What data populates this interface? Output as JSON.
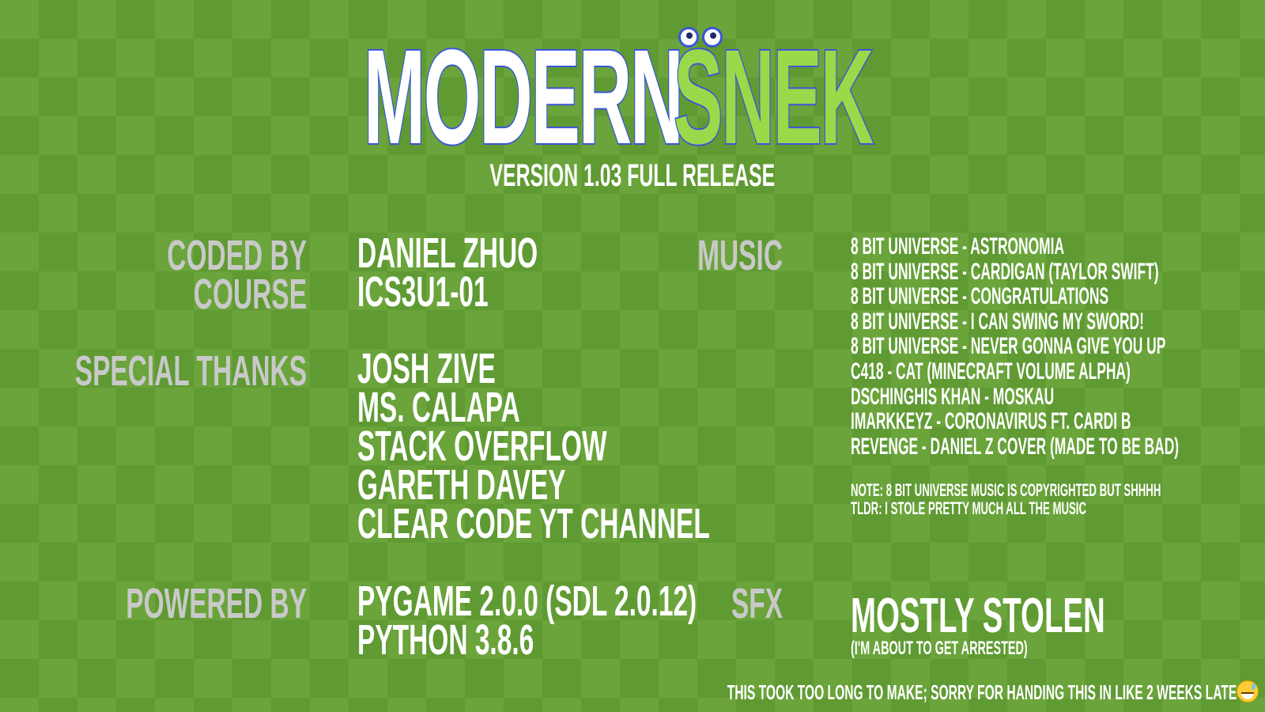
{
  "logo": {
    "word1": "MODERN",
    "word2": "SNEK"
  },
  "version": "VERSION 1.03 FULL RELEASE",
  "credits": {
    "coded_by_label": "CODED BY",
    "coded_by": "DANIEL ZHUO",
    "course_label": "COURSE",
    "course": "ICS3U1-01",
    "special_thanks_label": "SPECIAL THANKS",
    "special_thanks": [
      "JOSH ZIVE",
      "MS. CALAPA",
      "STACK OVERFLOW",
      "GARETH DAVEY",
      "CLEAR CODE YT CHANNEL"
    ],
    "powered_by_label": "POWERED BY",
    "powered_by": [
      "PYGAME 2.0.0 (SDL 2.0.12)",
      "PYTHON 3.8.6"
    ]
  },
  "music": {
    "label": "MUSIC",
    "tracks": [
      "8 BIT UNIVERSE - ASTRONOMIA",
      "8 BIT UNIVERSE - CARDIGAN (TAYLOR SWIFT)",
      "8 BIT UNIVERSE - CONGRATULATIONS",
      "8 BIT UNIVERSE - I CAN SWING MY SWORD!",
      "8 BIT UNIVERSE - NEVER GONNA GIVE YOU UP",
      "C418 - CAT (MINECRAFT VOLUME ALPHA)",
      "DSCHINGHIS KHAN - MOSKAU",
      "IMARKKEYZ - CORONAVIRUS FT. CARDI B",
      "REVENGE - DANIEL Z COVER (MADE TO BE BAD)"
    ],
    "note1": "NOTE: 8 BIT UNIVERSE MUSIC IS COPYRIGHTED BUT SHHHH",
    "note2": "TLDR: I STOLE PRETTY MUCH ALL THE MUSIC"
  },
  "sfx": {
    "label": "SFX",
    "value": "MOSTLY STOLEN",
    "sub": "(I'M ABOUT TO GET ARRESTED)"
  },
  "footer": "THIS TOOK TOO LONG TO MAKE; SORRY FOR HANDING THIS IN LIKE 2 WEEKS LATE",
  "footer_emoji": "grinning-sweat-emoji"
}
